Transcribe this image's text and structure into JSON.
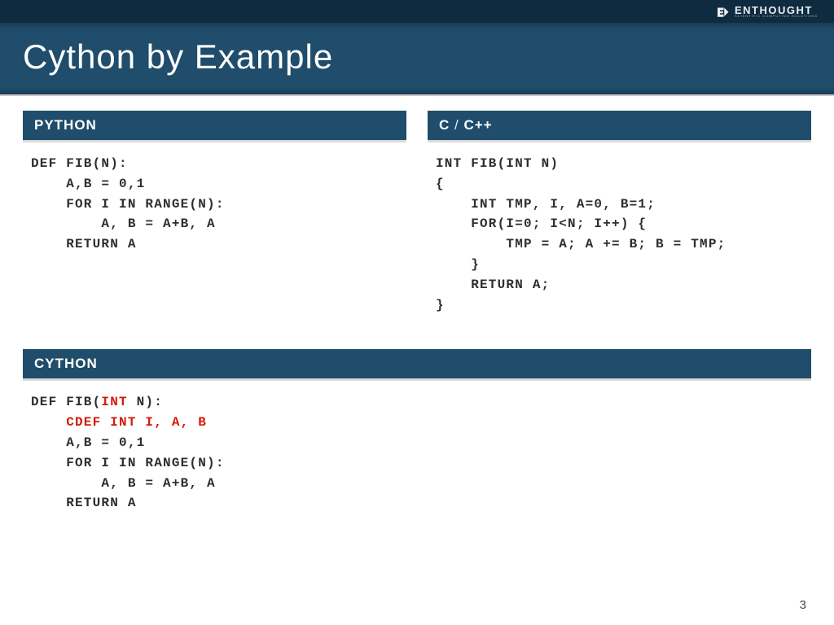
{
  "brand": {
    "name": "ENTHOUGHT",
    "tagline": "SCIENTIFIC COMPUTING SOLUTIONS"
  },
  "title": "Cython by Example",
  "python": {
    "header": "PYTHON",
    "code": "DEF FIB(N):\n    A,B = 0,1\n    FOR I IN RANGE(N):\n        A, B = A+B, A\n    RETURN A"
  },
  "c": {
    "header_a": "C",
    "header_sep": " / ",
    "header_b": "C++",
    "code": "INT FIB(INT N)\n{\n    INT TMP, I, A=0, B=1;\n    FOR(I=0; I<N; I++) {\n        TMP = A; A += B; B = TMP;\n    }\n    RETURN A;\n}"
  },
  "cython": {
    "header": "CYTHON",
    "line1_a": "DEF FIB(",
    "line1_b": "INT",
    "line1_c": " N):",
    "line2": "    CDEF INT I, A, B",
    "line3": "    A,B = 0,1",
    "line4": "    FOR I IN RANGE(N):",
    "line5": "        A, B = A+B, A",
    "line6": "    RETURN A"
  },
  "page": "3"
}
